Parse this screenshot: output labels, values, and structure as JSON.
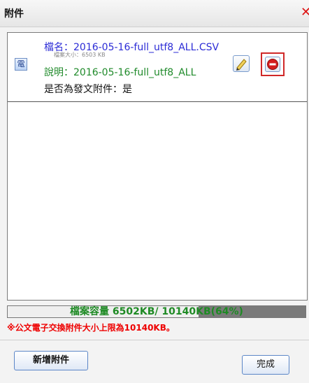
{
  "dialog": {
    "title": "附件"
  },
  "attachment": {
    "icon_text": "電",
    "filename_label": "檔名：",
    "filename": "2016-05-16-full_utf8_ALL.CSV",
    "size_text": "檔案大小：6503 KB",
    "description_label": "說明：",
    "description": "2016-05-16-full_utf8_ALL",
    "is_send_attachment": "是否為發文附件：是"
  },
  "capacity": {
    "text": "檔案容量 6502KB/ 10140KB(64%)",
    "used_kb": 6502,
    "limit_kb": 10140,
    "percent": 64
  },
  "limit_note": "※公文電子交換附件大小上限為10140KB。",
  "buttons": {
    "add": "新增附件",
    "done": "完成"
  },
  "colors": {
    "close": "#dd1111",
    "filename": "#2b2bd6",
    "description": "#1f8a2a",
    "progress_text": "#1e8a24",
    "warning": "#ee0000"
  }
}
